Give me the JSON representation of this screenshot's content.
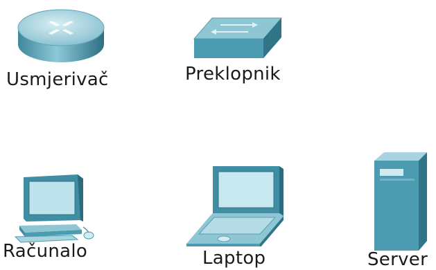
{
  "devices": {
    "router": {
      "label": "Usmjerivač",
      "icon": "router-icon"
    },
    "switch": {
      "label": "Preklopnik",
      "icon": "switch-icon"
    },
    "pc": {
      "label": "Računalo",
      "icon": "pc-icon"
    },
    "laptop": {
      "label": "Laptop",
      "icon": "laptop-icon"
    },
    "server": {
      "label": "Server",
      "icon": "server-icon"
    }
  },
  "colors": {
    "device_top": "#a9d3de",
    "device_face": "#4b9cb0",
    "device_side": "#2f7487",
    "label_text": "#1a1a1a"
  }
}
